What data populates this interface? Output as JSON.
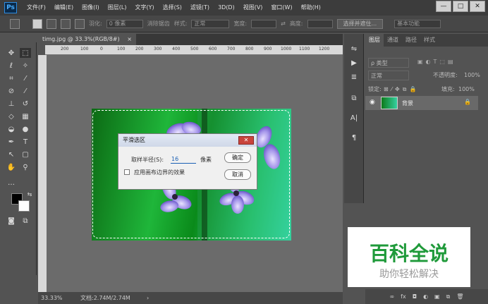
{
  "app": {
    "logo": "Ps"
  },
  "menu": [
    "文件(F)",
    "编辑(E)",
    "图像(I)",
    "图层(L)",
    "文字(Y)",
    "选择(S)",
    "滤镜(T)",
    "3D(D)",
    "视图(V)",
    "窗口(W)",
    "帮助(H)"
  ],
  "window_buttons": {
    "minimize": "—",
    "restore": "□",
    "close": "✕"
  },
  "options": {
    "feather_label": "羽化:",
    "feather_value": "0 像素",
    "antialias_label": "消除锯齿",
    "style_label": "样式:",
    "style_value": "正常",
    "width_label": "宽度:",
    "height_label": "高度:",
    "select_mask_button": "选择并遮住...",
    "workspace": "基本功能"
  },
  "document": {
    "tab_title": "timg.jpg @ 33.3%(RGB/8#)",
    "tab_close": "×",
    "ruler_ticks": [
      "200",
      "100",
      "0",
      "100",
      "200",
      "300",
      "400",
      "500",
      "600",
      "700",
      "800",
      "900",
      "1000",
      "1100",
      "1200"
    ],
    "zoom": "33.33%",
    "doc_info": "文档:2.74M/2.74M"
  },
  "dialog": {
    "title": "平滑选区",
    "close": "✕",
    "radius_label": "取样半径(S):",
    "radius_value": "16",
    "unit": "像素",
    "checkbox_label": "应用画布边界的效果",
    "ok_button": "确定",
    "cancel_button": "取消"
  },
  "side_icons": [
    "⇋",
    "▶",
    "≣",
    "⧉",
    "A|",
    "¶"
  ],
  "layers_panel": {
    "tabs": [
      "图层",
      "通道",
      "路径",
      "样式"
    ],
    "kind_label": "ρ 类型",
    "blend_mode": "正常",
    "opacity_label": "不透明度:",
    "opacity_value": "100%",
    "lock_label": "锁定:",
    "fill_label": "填充:",
    "fill_value": "100%",
    "layer_name": "背景",
    "footer_icons": [
      "∞",
      "fx",
      "◘",
      "◐",
      "▣",
      "⧉",
      "🗑"
    ]
  },
  "watermark": {
    "line1": "百科全说",
    "line2": "助你轻松解决"
  }
}
